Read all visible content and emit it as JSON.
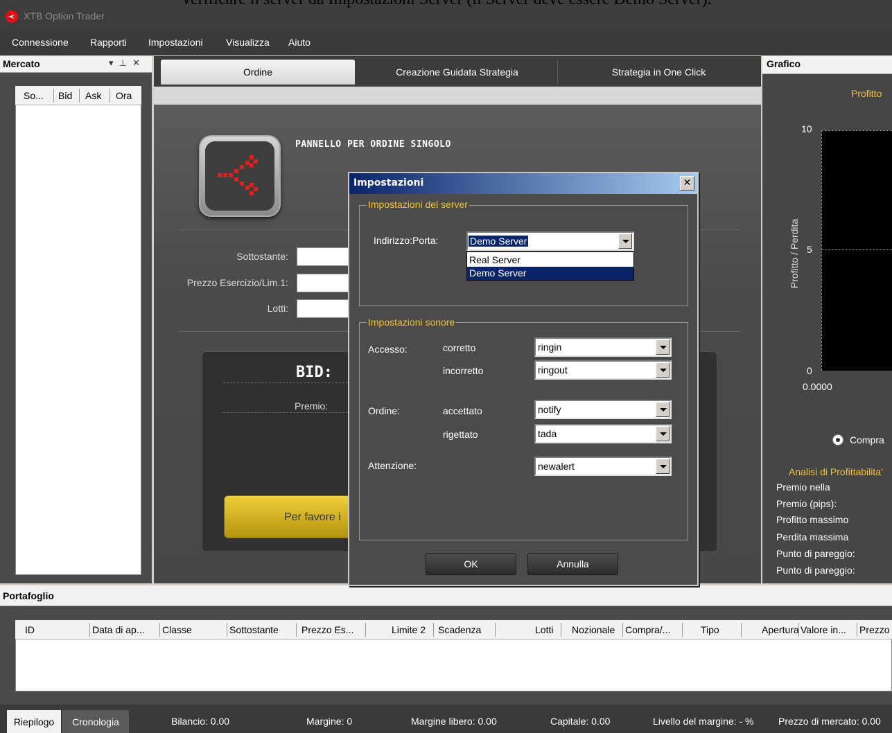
{
  "caption": "Verificare il server da Impostazioni Server (il Server deve essere Demo Server).",
  "app": {
    "title": "XTB Option Trader"
  },
  "menu": [
    "Connessione",
    "Rapporti",
    "Impostazioni",
    "Visualizza",
    "Aiuto"
  ],
  "mercato": {
    "title": "Mercato",
    "controls": "▾ ⊥ ✕",
    "columns": [
      "So...",
      "Bid",
      "Ask",
      "Ora"
    ]
  },
  "tabs": [
    "Ordine",
    "Creazione Guidata Strategia",
    "Strategia in One Click"
  ],
  "order_panel": {
    "title": "PANNELLO PER ORDINE SINGOLO",
    "fields": [
      "Sottostante:",
      "Prezzo Esercizio/Lim.1:",
      "Lotti:"
    ],
    "bid_label": "BID:",
    "premio_label": "Premio:",
    "button_label": "Per favore i"
  },
  "grafico": {
    "title": "Grafico",
    "chart_title": "Profitto",
    "y_ticks": [
      "10",
      "5",
      "0"
    ],
    "y_axis_label": "Profitto / Perdita",
    "x_tick": "0.0000",
    "radio_label": "Compra",
    "analisi_title": "Analisi di Profittabilita'",
    "analisi_rows": [
      "Premio nella",
      "Premio (pips):",
      "Profitto massimo",
      "Perdita massima",
      "Punto di pareggio:",
      "Punto di pareggio:"
    ]
  },
  "portafoglio": {
    "title": "Portafoglio",
    "columns": [
      "ID",
      "Data di ap...",
      "Classe",
      "Sottostante",
      "Prezzo Es...",
      "Limite 2",
      "Scadenza",
      "Lotti",
      "Nozionale",
      "Compra/...",
      "Tipo",
      "Apertura",
      "Valore in...",
      "Prezzo"
    ]
  },
  "statusbar": {
    "tabs": [
      "Riepilogo",
      "Cronologia"
    ],
    "items": [
      "Bilancio: 0.00",
      "Margine: 0",
      "Margine libero: 0.00",
      "Capitale: 0.00",
      "Livello del margine: - %",
      "Prezzo di mercato: 0.00"
    ]
  },
  "dialog": {
    "title": "Impostazioni",
    "close_glyph": "✕",
    "server_group": {
      "legend": "Impostazioni del server",
      "label": "Indirizzo:Porta:",
      "value": "Demo Server",
      "options": [
        "Real Server",
        "Demo Server"
      ]
    },
    "sound_group": {
      "legend": "Impostazioni sonore",
      "section_accesso": "Accesso:",
      "section_ordine": "Ordine:",
      "section_attenzione": "Attenzione:",
      "rows": [
        {
          "label": "corretto",
          "value": "ringin"
        },
        {
          "label": "incorretto",
          "value": "ringout"
        },
        {
          "label": "accettato",
          "value": "notify"
        },
        {
          "label": "rigettato",
          "value": "tada"
        },
        {
          "label": "",
          "value": "newalert"
        }
      ]
    },
    "ok_label": "OK",
    "cancel_label": "Annulla"
  }
}
